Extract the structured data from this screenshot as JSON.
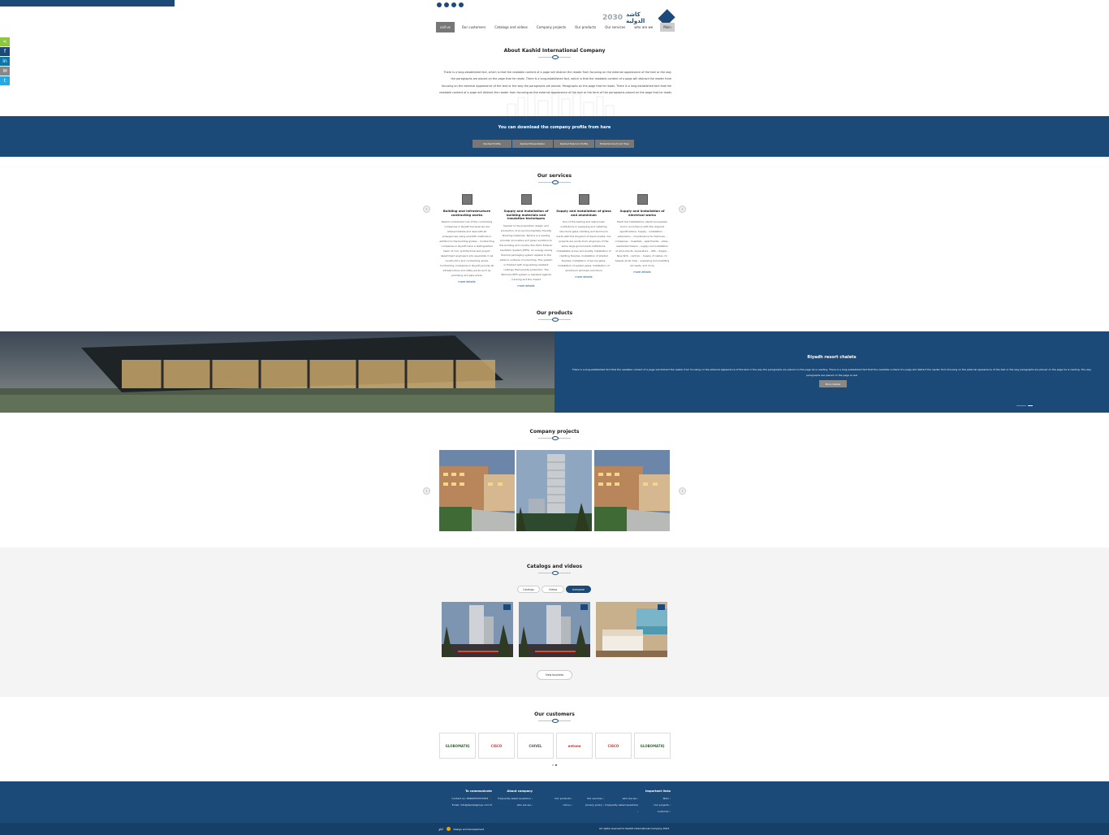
{
  "header": {
    "contact_line": "",
    "logo_vision": "2030",
    "logo_name": "كاشد الدولية",
    "nav": [
      {
        "label": "call us",
        "active": true
      },
      {
        "label": "Our customers"
      },
      {
        "label": "Catalogs and videos"
      },
      {
        "label": "Company projects"
      },
      {
        "label": "Our products"
      },
      {
        "label": "Our services"
      },
      {
        "label": "who are we"
      },
      {
        "label": "Main"
      }
    ]
  },
  "share": [
    "<",
    "f",
    "in",
    "✉",
    "t"
  ],
  "about": {
    "title": "About Kashid International Company",
    "text": "There is a long-established fact, which is that the readable content of a page will distract the reader from focusing on the external appearance of the text or the way the paragraphs are placed on the page that he reads. There is a long-established fact, which is that the readable content of a page will distract the reader from focusing on the external appearance of the text or the way the paragraphs are placed. Paragraphs on the page that he reads. There is a long-established fact that the readable content of a page will distract the reader from focusing on the external appearance of the text or the form of the paragraphs placed on the page that he reads"
  },
  "profile": {
    "title": "You can download the company profile from here",
    "buttons": [
      "Kashed Profile",
      "Kashed Presentation",
      "Kashed Telecom Profile",
      "Entertainment and Toys"
    ]
  },
  "services": {
    "title": "Our services",
    "items": [
      {
        "title": "Building and infrastructure contracting works",
        "desc": "Kashid contributed one of the contracting companies in Riyadh because we are advised details and deal with all emergencies using scientific methods in addition to the building grades – Contracting companies in Riyadh have a distinguished team of civil, architectural and project department engineers who specialize in all construction and contracting works. Contracting companies in Riyadh provide all infrastructure and utility works such as plumbing and pipe works",
        "more": "more details"
      },
      {
        "title": "Supply and installation of building materials and insulation techniques",
        "desc": "Kashed is the proposition design and production of an environmentally friendly finishing materials. Tamma is a leading provider innovative and green solutions to the building and construction field. Exterior Insulation System (EIFS). An energy saving thermal packaging system applied to the exterior surfaces of a building. This system is finished with long-lasting resistant coatings that provide protection. The Tamma's EIFS system is resistant against cracking and the impact",
        "more": "more details"
      },
      {
        "title": "Supply and installation of glass and aluminium",
        "desc": "One of the leading and well-known institutions in supplying and installing structural glass cladding and aluminum works with the Kingdom of Saudi Arabia. Our projects are works from all groups of the same large government institutions. Unbeatable prices and quality. Installation of cladding facades. Installation of shaded facades. Installation of secure glass. Installation of system glass. Installation of aluminium windows and doors",
        "more": "more details"
      },
      {
        "title": "Supply and installation of electrical works",
        "desc": "Electrical installations, electrical supplies and in accordance with the required specifications. Supply – installation – extensions – maintenance for factories – companies – hospitals – apartments – villas – residential towers – supply and installation of all products. Generators – UPS – Supply – New SDS – central. – Supply of cables. Or Sewels all all lines – supplying and installing all needs. and more",
        "more": "more details"
      }
    ]
  },
  "products": {
    "title": "Our products",
    "item_title": "Riyadh resort chalets",
    "item_desc": "There is a long-established fact that the readable content of a page will distract the reader from focusing on the external appearance of the text or the way the paragraphs are placed on the page he is reading. There is a long-established fact that the readable content of a page will distract the reader from focusing on the external appearance of the text or the way paragraphs are placed on the page he is reading. The way paragraphs are placed on the page is real",
    "button": "More details"
  },
  "projects": {
    "title": "Company projects"
  },
  "catalogs": {
    "title": "Catalogs and videos",
    "tabs": [
      "Catalogs",
      "Videos",
      "everyone"
    ],
    "view_all": "View business"
  },
  "customers": {
    "title": "Our customers",
    "logos": [
      "GLOBOMATIQ",
      "CISCO",
      "CHIVEL",
      "entone",
      "CISCO",
      "GLOBOMATIQ"
    ]
  },
  "footer": {
    "col_contact": {
      "title": "To communicate",
      "lines": [
        "Contact us: 00966559379303 📞",
        "Email: info@kashedgroup.com ✉"
      ]
    },
    "col_about": {
      "title": "About company",
      "lines": [
        "frequently asked questions ›",
        "who are we ›"
      ]
    },
    "col_links1": {
      "lines": [
        "Our products ›",
        "call us ›"
      ]
    },
    "col_links2": {
      "lines": [
        "Our services ›",
        "privacy policy ›"
      ]
    },
    "col_links3": {
      "lines": [
        "who are we ›",
        "frequently asked questions ›"
      ]
    },
    "col_important": {
      "title": "Important links",
      "lines": [
        "Main ›",
        "Our projects ›",
        "customer ›"
      ]
    },
    "credit": "Design and development",
    "credit_brand": "أفاق",
    "copyright": "All rights reserved to Kashid International Company 2023"
  }
}
